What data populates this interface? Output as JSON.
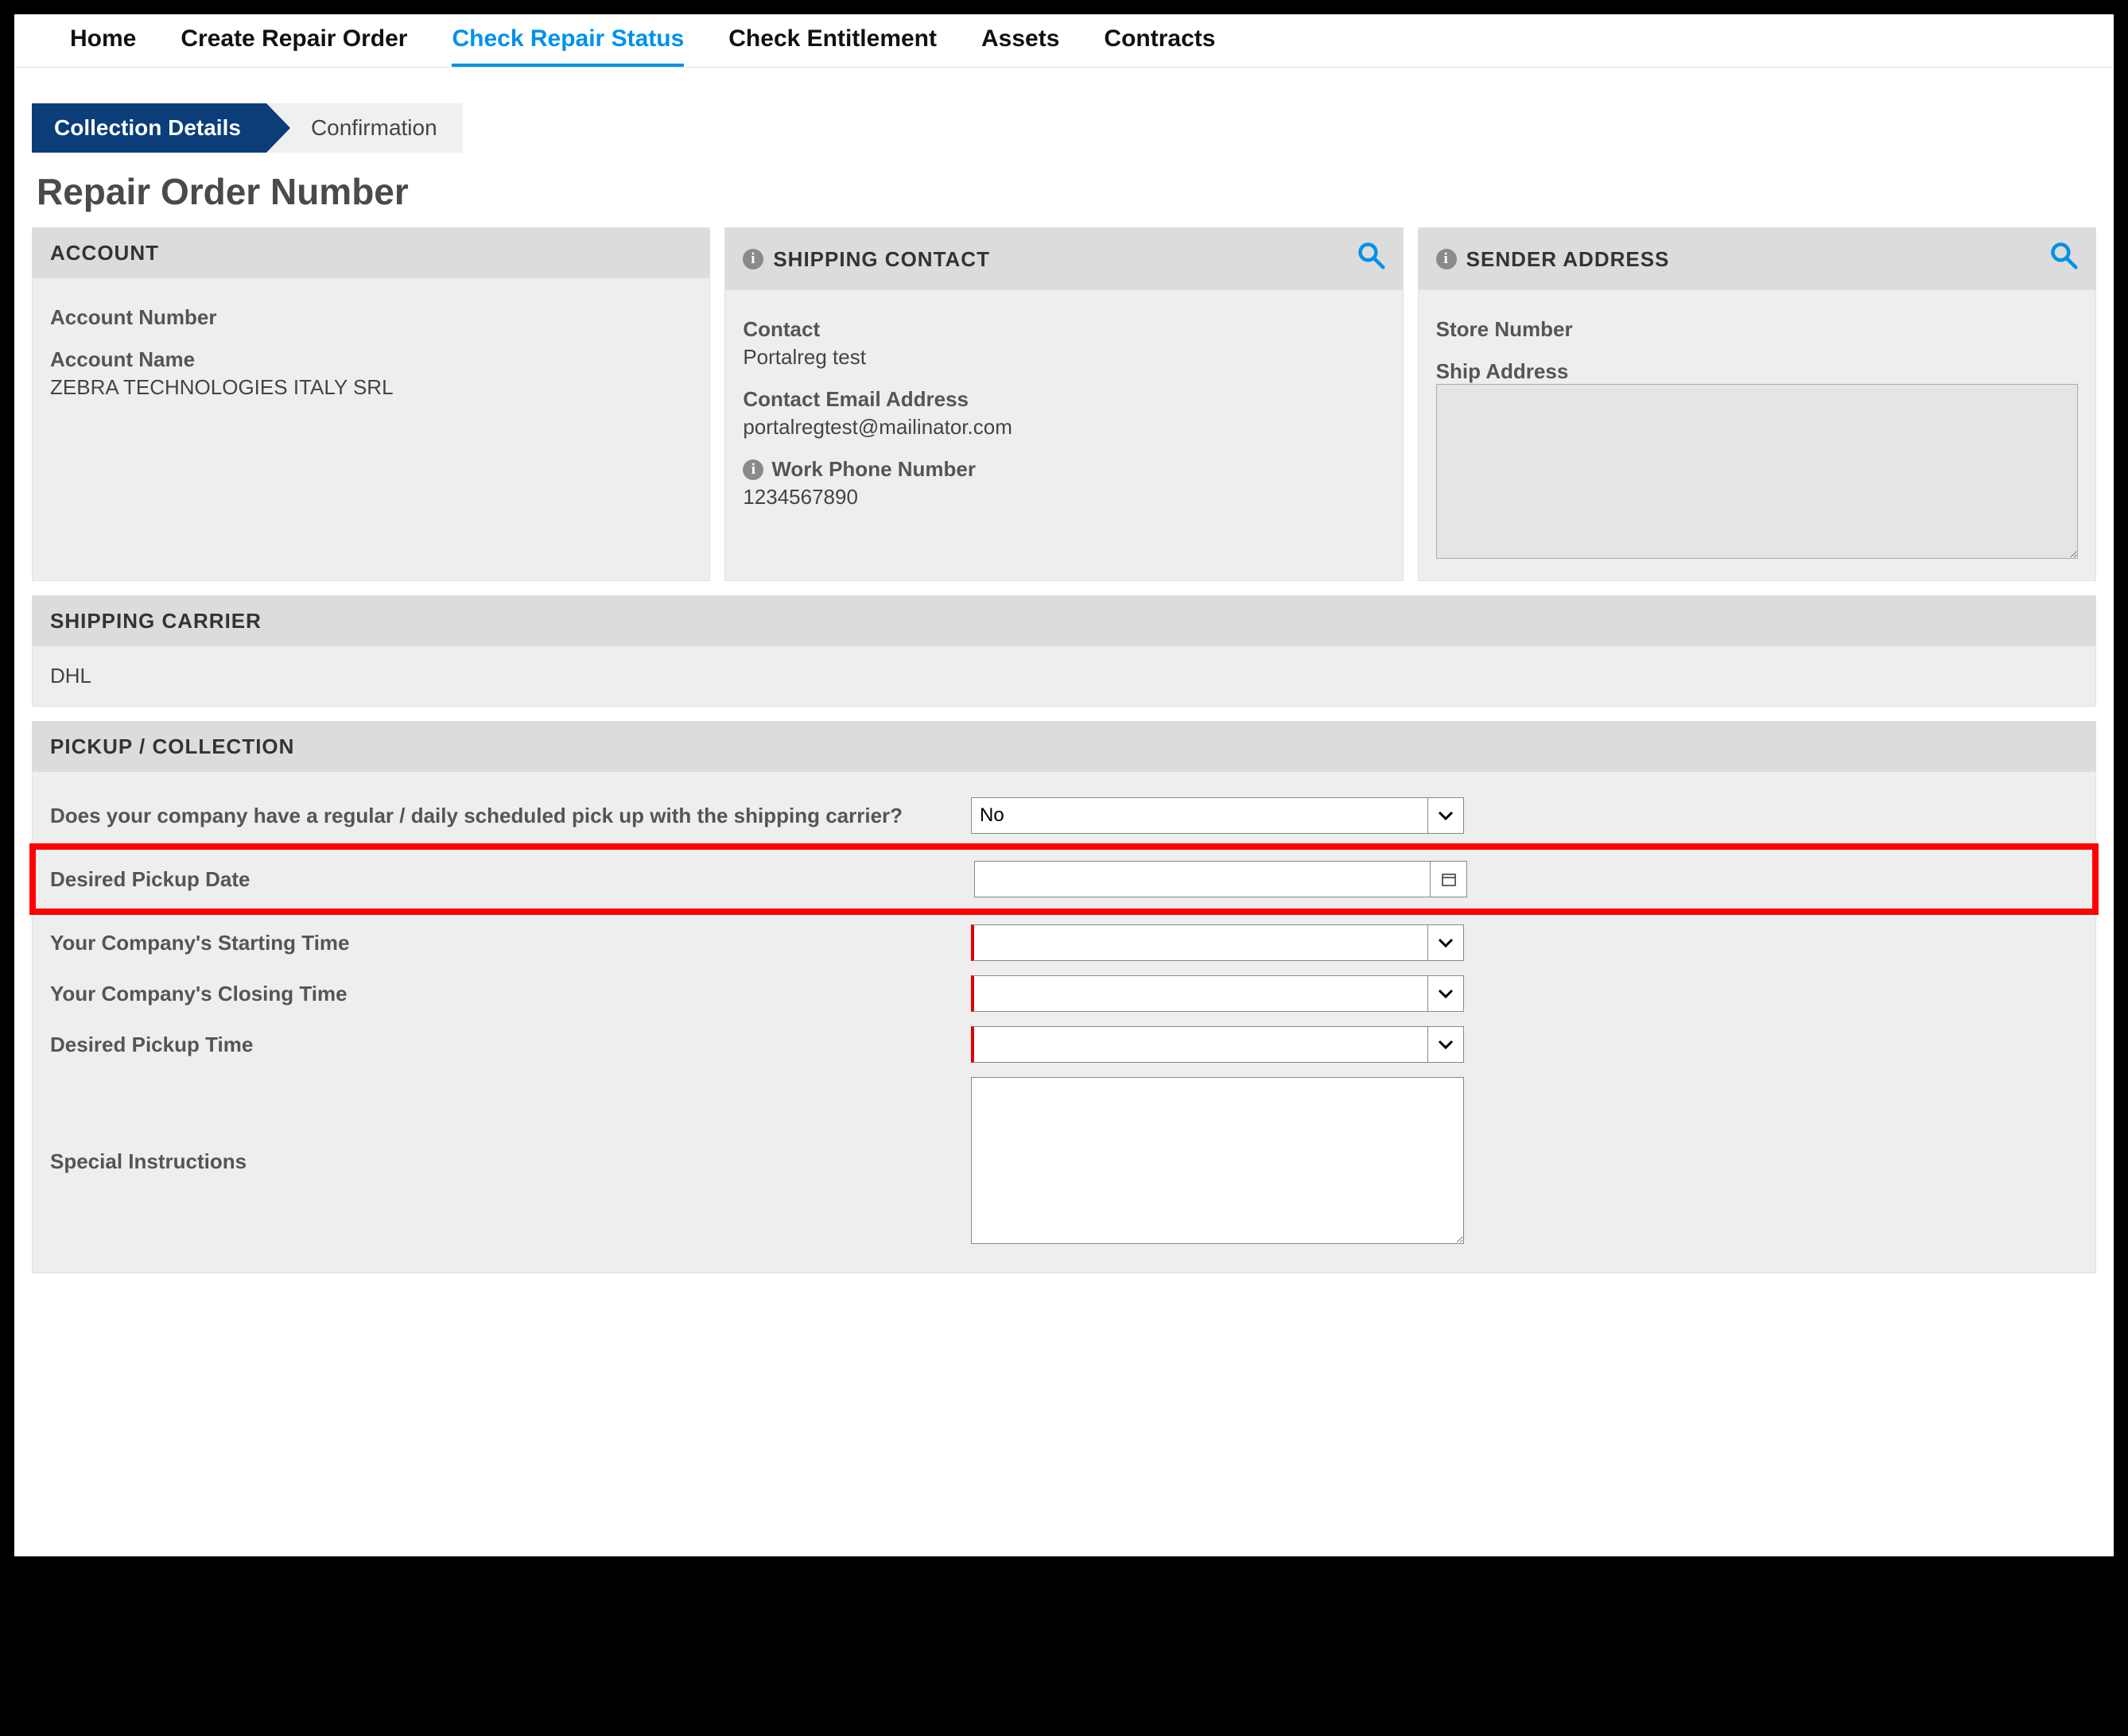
{
  "nav": {
    "items": [
      {
        "label": "Home",
        "active": false
      },
      {
        "label": "Create Repair Order",
        "active": false
      },
      {
        "label": "Check Repair Status",
        "active": true
      },
      {
        "label": "Check Entitlement",
        "active": false
      },
      {
        "label": "Assets",
        "active": false
      },
      {
        "label": "Contracts",
        "active": false
      }
    ]
  },
  "steps": {
    "active": "Collection Details",
    "inactive": "Confirmation"
  },
  "page_title": "Repair Order Number",
  "account": {
    "header": "ACCOUNT",
    "number_label": "Account Number",
    "number_value": "",
    "name_label": "Account Name",
    "name_value": "ZEBRA TECHNOLOGIES ITALY SRL"
  },
  "shipping_contact": {
    "header": "SHIPPING CONTACT",
    "contact_label": "Contact",
    "contact_value": "Portalreg test",
    "email_label": "Contact Email Address",
    "email_value": "portalregtest@mailinator.com",
    "phone_label": "Work Phone Number",
    "phone_value": "1234567890"
  },
  "sender": {
    "header": "SENDER ADDRESS",
    "store_label": "Store Number",
    "store_value": "",
    "ship_label": "Ship Address",
    "ship_value": ""
  },
  "carrier": {
    "header": "SHIPPING CARRIER",
    "value": "DHL"
  },
  "pickup": {
    "header": "PICKUP / COLLECTION",
    "regular_label": "Does your company have a regular / daily scheduled pick up with the shipping carrier?",
    "regular_value": "No",
    "date_label": "Desired Pickup Date",
    "date_value": "",
    "start_label": "Your Company's Starting Time",
    "start_value": "",
    "close_label": "Your Company's Closing Time",
    "close_value": "",
    "pickup_time_label": "Desired Pickup Time",
    "pickup_time_value": "",
    "special_label": "Special Instructions",
    "special_value": ""
  }
}
